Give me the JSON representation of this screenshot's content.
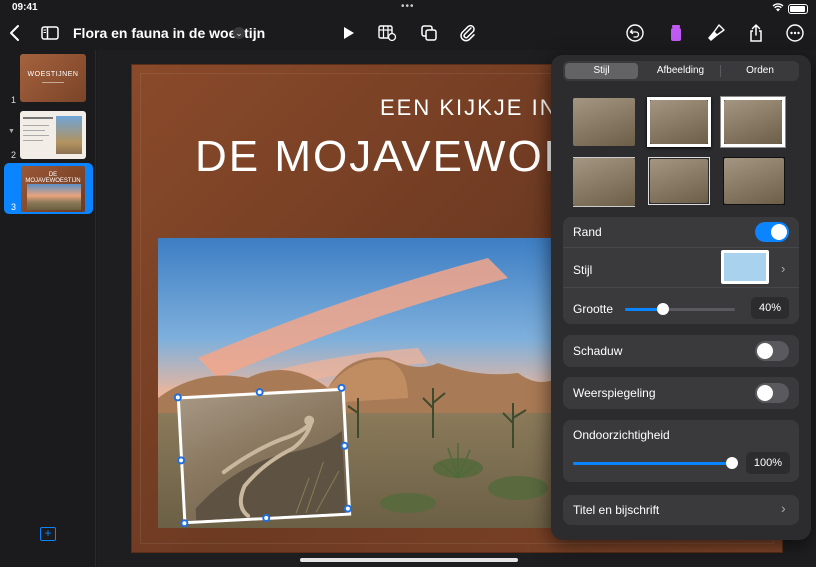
{
  "status": {
    "time": "09:41",
    "dots": "•••"
  },
  "document": {
    "title": "Flora en fauna in de woestijn"
  },
  "slides": [
    {
      "number": "1",
      "title": "WOESTIJNEN"
    },
    {
      "number": "2"
    },
    {
      "number": "3",
      "title": "DE MOJAVEWOESTIJN",
      "selected": true
    }
  ],
  "slide": {
    "line1": "EEN KIJKJE IN",
    "line2": "DE MOJAVEWOESTIJN"
  },
  "panel": {
    "tabs": [
      "Stijl",
      "Afbeelding",
      "Orden"
    ],
    "active_tab": "Stijl",
    "border": {
      "label": "Rand",
      "on": true
    },
    "style": {
      "label": "Stijl",
      "swatch_color": "#a9d2ee"
    },
    "size": {
      "label": "Grootte",
      "value": "40%",
      "fraction": 0.4
    },
    "shadow": {
      "label": "Schaduw",
      "on": false
    },
    "reflection": {
      "label": "Weerspiegeling",
      "on": false
    },
    "opacity": {
      "label": "Ondoorzichtigheid",
      "value": "100%",
      "fraction": 1.0
    },
    "caption": {
      "label": "Titel en bijschrift"
    }
  },
  "colors": {
    "accent": "#0a84ff",
    "panel_bg": "#2c2c2e"
  },
  "icons": {
    "back": "chevron-left-icon",
    "sidebar": "sidebar-icon",
    "play": "play-icon",
    "table": "table-icon",
    "shapes": "shapes-icon",
    "attach": "paperclip-icon",
    "undo": "undo-icon",
    "format": "format-icon",
    "brush": "brush-icon",
    "share": "share-icon",
    "more": "more-icon"
  }
}
